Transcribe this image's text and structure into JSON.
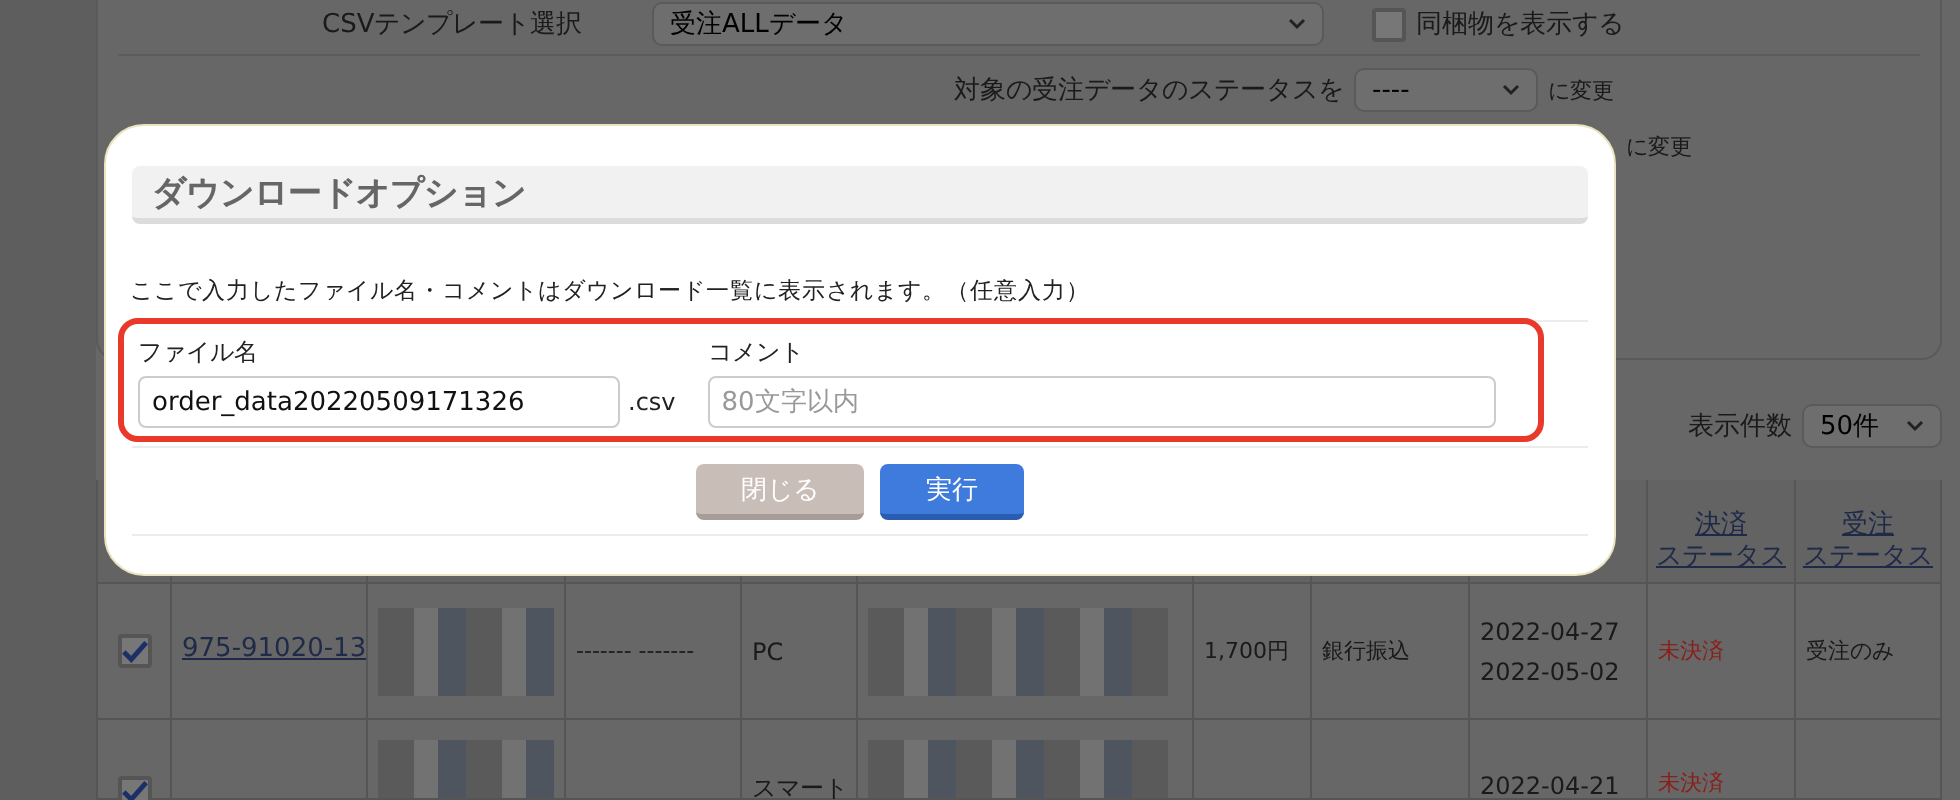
{
  "csv_template": {
    "label": "CSVテンプレート選択",
    "value": "受注ALLデータ"
  },
  "bundle_toggle": {
    "label": "同梱物を表示する",
    "checked": false
  },
  "status_change": {
    "label": "対象の受注データのステータスを",
    "value": "----",
    "suffix": "に変更"
  },
  "status_change_2": {
    "suffix": "に変更"
  },
  "page_size": {
    "label": "表示件数",
    "value": "50件"
  },
  "table": {
    "columns": [
      {},
      {},
      {},
      {},
      {},
      {},
      {},
      {},
      {},
      {
        "label": "決済",
        "label_2": "ステータス"
      },
      {
        "label": "受注",
        "label_2": "ステータス"
      }
    ],
    "rows": [
      {
        "checked": true,
        "order_no": "975-91020-13",
        "ad_code": "------- -------",
        "device": "PC",
        "amount": "1,700円",
        "payment": "銀行振込",
        "dates": [
          "2022-04-27",
          "2022-05-02"
        ],
        "payment_status": "未決済",
        "order_status": "受注のみ"
      },
      {
        "checked": true,
        "device": "スマート",
        "dates": [
          "2022-04-21"
        ],
        "payment_status": "未決済"
      }
    ]
  },
  "modal": {
    "title": "ダウンロードオプション",
    "description": "ここで入力したファイル名・コメントはダウンロード一覧に表示されます。（任意入力）",
    "file_name": {
      "label": "ファイル名",
      "value": "order_data20220509171326",
      "extension": ".csv"
    },
    "comment": {
      "label": "コメント",
      "placeholder": "80文字以内"
    },
    "buttons": [
      {
        "kind": "secondary",
        "label": "閉じる"
      },
      {
        "kind": "primary",
        "label": "実行"
      }
    ]
  }
}
